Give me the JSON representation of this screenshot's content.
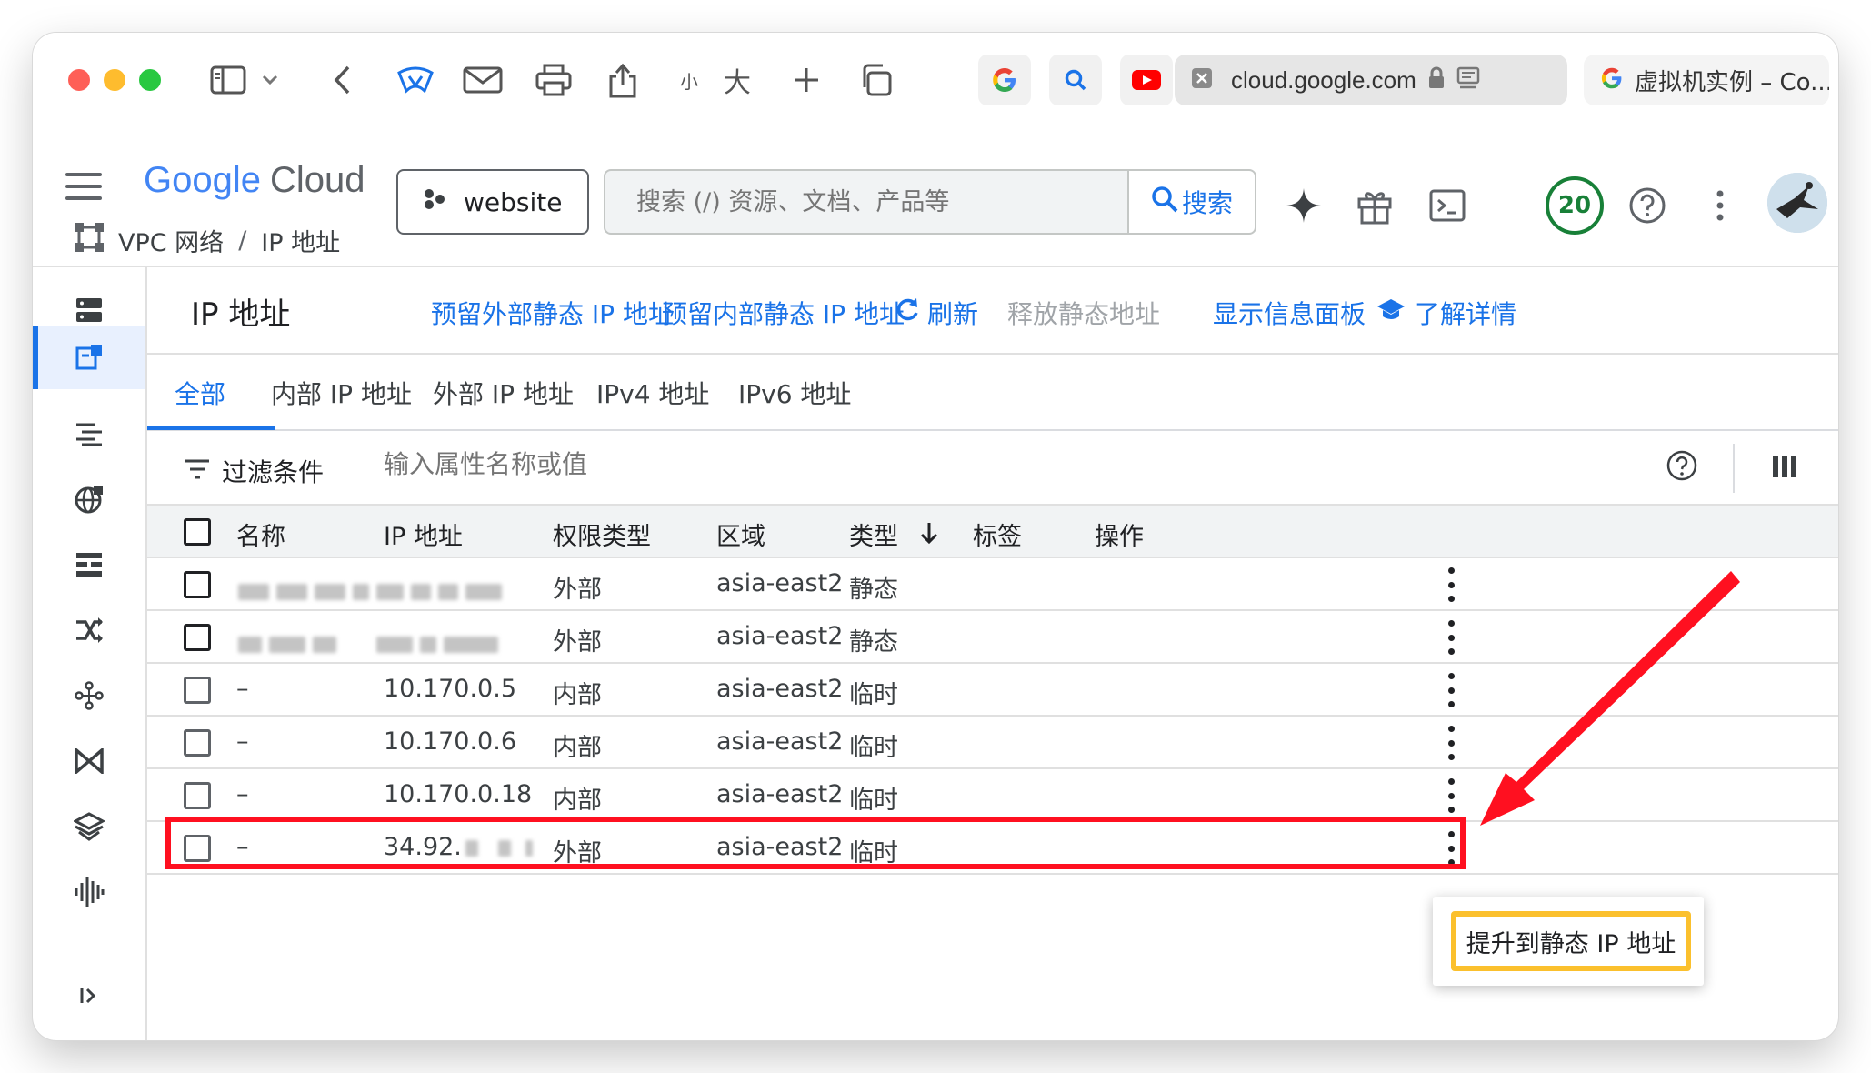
{
  "browser": {
    "url": "cloud.google.com",
    "tab_title": "虚拟机实例 – Co...",
    "toolbar": {
      "small_text": "小",
      "large_text": "大"
    }
  },
  "header": {
    "logo": {
      "google": "Google",
      "cloud": "Cloud"
    },
    "project": "website",
    "search": {
      "placeholder": "搜索 (/) 资源、文档、产品等",
      "button": "搜索"
    },
    "notification_count": "20"
  },
  "breadcrumb": {
    "parent": "VPC 网络",
    "separator": "/",
    "current": "IP 地址"
  },
  "page": {
    "title": "IP 地址",
    "actions": {
      "reserve_external": "预留外部静态 IP 地址",
      "reserve_internal": "预留内部静态 IP 地址",
      "refresh": "刷新",
      "release": "释放静态地址",
      "show_info_panel": "显示信息面板",
      "learn_more": "了解详情"
    },
    "tabs": [
      "全部",
      "内部 IP 地址",
      "外部 IP 地址",
      "IPv4 地址",
      "IPv6 地址"
    ],
    "filter": {
      "label": "过滤条件",
      "placeholder": "输入属性名称或值"
    }
  },
  "table": {
    "columns": {
      "name": "名称",
      "ip": "IP 地址",
      "access": "权限类型",
      "region": "区域",
      "type": "类型",
      "labels": "标签",
      "actions": "操作"
    },
    "rows": [
      {
        "name": "",
        "ip": "",
        "access": "外部",
        "region": "asia-east2",
        "type": "静态"
      },
      {
        "name": "",
        "ip": "",
        "access": "外部",
        "region": "asia-east2",
        "type": "静态"
      },
      {
        "name": "–",
        "ip": "10.170.0.5",
        "access": "内部",
        "region": "asia-east2",
        "type": "临时"
      },
      {
        "name": "–",
        "ip": "10.170.0.6",
        "access": "内部",
        "region": "asia-east2",
        "type": "临时"
      },
      {
        "name": "–",
        "ip": "10.170.0.18",
        "access": "内部",
        "region": "asia-east2",
        "type": "临时"
      },
      {
        "name": "–",
        "ip": "34.92.",
        "access": "外部",
        "region": "asia-east2",
        "type": "临时"
      }
    ]
  },
  "popup_menu": {
    "promote": "提升到静态 IP 地址"
  },
  "colors": {
    "accent": "#1a73e8",
    "highlight": "#ff1020",
    "popup_border": "#fbc02d",
    "badge": "#188038"
  }
}
